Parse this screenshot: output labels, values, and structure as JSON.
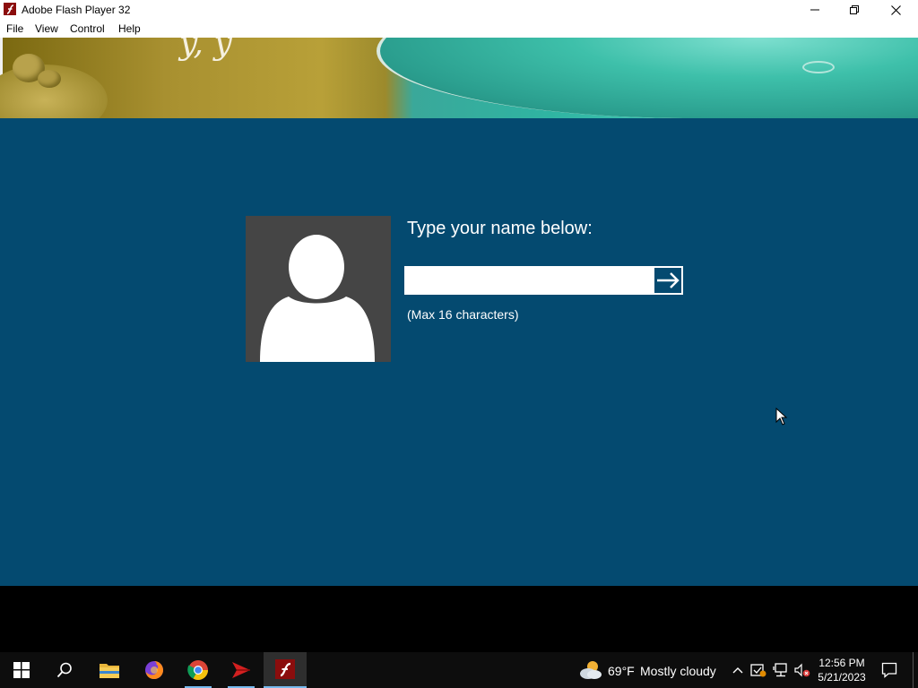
{
  "window": {
    "title": "Adobe Flash Player 32"
  },
  "menu": {
    "items": [
      "File",
      "View",
      "Control",
      "Help"
    ]
  },
  "stage": {
    "banner_text": "y, y",
    "prompt": "Type your name below:",
    "name_input": {
      "value": "",
      "placeholder": ""
    },
    "hint": "(Max 16 characters)",
    "background_color": "#044a70"
  },
  "taskbar": {
    "weather": {
      "temp": "69°F",
      "condition": "Mostly cloudy"
    },
    "clock": {
      "time": "12:56 PM",
      "date": "5/21/2023"
    },
    "apps": [
      "start-icon",
      "search-icon",
      "file-explorer-icon",
      "firefox-icon",
      "chrome-icon",
      "red-app-icon",
      "flash-player-icon"
    ]
  }
}
